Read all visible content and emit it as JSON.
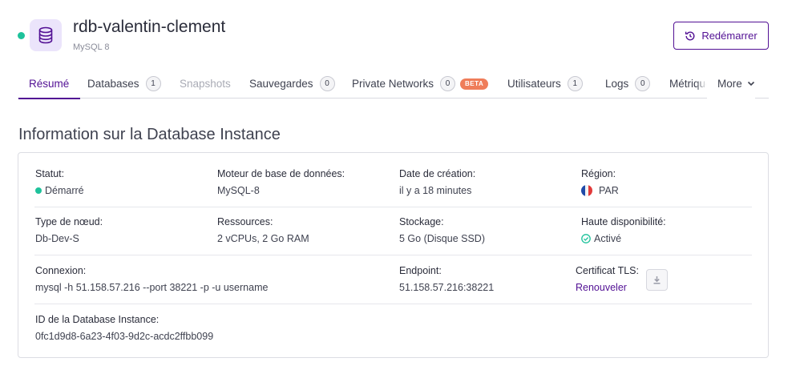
{
  "header": {
    "title": "rdb-valentin-clement",
    "subtitle": "MySQL 8",
    "status_color": "#1ec29b",
    "icon": "database-icon",
    "restart_label": "Redémarrer",
    "restart_icon": "restart-icon"
  },
  "tabs": {
    "items": [
      {
        "label": "Résumé",
        "active": true
      },
      {
        "label": "Databases",
        "count": "1"
      },
      {
        "label": "Snapshots",
        "disabled": true
      },
      {
        "label": "Sauvegardes",
        "count": "0"
      },
      {
        "label": "Private Networks",
        "count": "0",
        "badge": "BETA"
      },
      {
        "label": "Utilisateurs",
        "count": "1"
      },
      {
        "label": "Logs",
        "count": "0"
      },
      {
        "label": "Métriques"
      }
    ],
    "more_label": "More"
  },
  "section": {
    "title": "Information sur la Database Instance"
  },
  "info": {
    "statut": {
      "label": "Statut:",
      "value": "Démarré"
    },
    "moteur": {
      "label": "Moteur de base de données:",
      "value": "MySQL-8"
    },
    "date": {
      "label": "Date de création:",
      "value": "il y a 18 minutes"
    },
    "region": {
      "label": "Région:",
      "value": "PAR"
    },
    "type": {
      "label": "Type de nœud:",
      "value": "Db-Dev-S"
    },
    "ressources": {
      "label": "Ressources:",
      "value": "2 vCPUs, 2 Go RAM"
    },
    "stockage": {
      "label": "Stockage:",
      "value": "5 Go (Disque SSD)"
    },
    "ha": {
      "label": "Haute disponibilité:",
      "value": "Activé"
    },
    "connexion": {
      "label": "Connexion:",
      "value": "mysql -h 51.158.57.216 --port 38221 -p -u username"
    },
    "endpoint": {
      "label": "Endpoint:",
      "value": "51.158.57.216:38221"
    },
    "tls": {
      "label": "Certificat TLS:",
      "link": "Renouveler"
    },
    "id": {
      "label": "ID de la Database Instance:",
      "value": "0fc1d9d8-6a23-4f03-9d2c-acdc2ffbb099"
    }
  },
  "colors": {
    "accent": "#521094",
    "success": "#1ec29b",
    "beta_badge": "#ef7d5a"
  }
}
